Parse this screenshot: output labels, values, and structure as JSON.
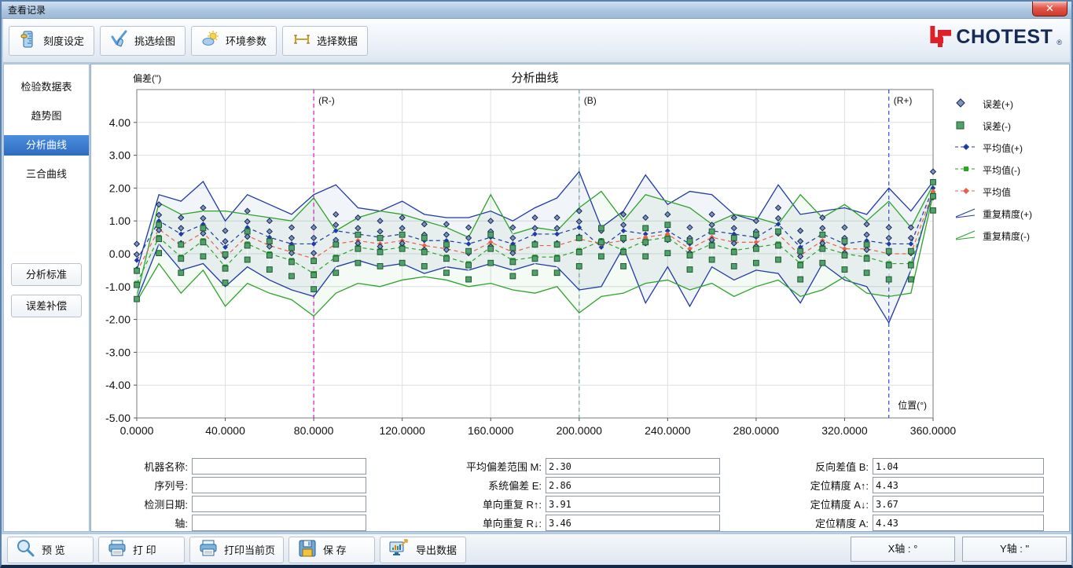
{
  "window": {
    "title": "查看记录",
    "close_glyph": "✕"
  },
  "brand": {
    "name": "CHOTEST",
    "registered": "®",
    "navy": "#152a56",
    "red": "#e02028"
  },
  "toolbar": {
    "buttons": [
      {
        "label": "刻度设定",
        "icon": "ruler-icon"
      },
      {
        "label": "挑选绘图",
        "icon": "pick-draw-icon"
      },
      {
        "label": "环境参数",
        "icon": "environment-icon"
      },
      {
        "label": "选择数据",
        "icon": "select-data-icon"
      }
    ]
  },
  "sidebar": {
    "items": [
      {
        "label": "检验数据表",
        "active": false
      },
      {
        "label": "趋势图",
        "active": false
      },
      {
        "label": "分析曲线",
        "active": true
      },
      {
        "label": "三合曲线",
        "active": false
      }
    ],
    "buttons": [
      {
        "label": "分析标准"
      },
      {
        "label": "误差补偿"
      }
    ]
  },
  "chart_data": {
    "type": "line",
    "title": "分析曲线",
    "ylabel": "偏差(\")",
    "xlabel": "位置(°)",
    "xlim": [
      0,
      360
    ],
    "ylim": [
      -5,
      5
    ],
    "x_tick_labels": [
      "0.0000",
      "40.0000",
      "80.0000",
      "120.0000",
      "160.0000",
      "200.0000",
      "240.0000",
      "280.0000",
      "320.0000",
      "360.0000"
    ],
    "y_tick_labels": [
      "4.00",
      "3.00",
      "2.00",
      "1.00",
      "0.00",
      "-1.00",
      "-2.00",
      "-3.00",
      "-4.00",
      "-5.00"
    ],
    "grid": true,
    "legend_position": "right-outside",
    "reference_lines": [
      {
        "label": "(R-)",
        "x": 80,
        "color": "#e316c8"
      },
      {
        "label": "(B)",
        "x": 200,
        "color": "#7ba3a3"
      },
      {
        "label": "(R+)",
        "x": 340,
        "color": "#2f48d5"
      }
    ],
    "x": [
      0,
      10,
      20,
      30,
      40,
      50,
      60,
      70,
      80,
      90,
      100,
      110,
      120,
      130,
      140,
      150,
      160,
      170,
      180,
      190,
      200,
      210,
      220,
      230,
      240,
      250,
      260,
      270,
      280,
      290,
      300,
      310,
      320,
      330,
      340,
      350,
      360
    ],
    "series": [
      {
        "name": "误差(+)",
        "type": "scatter",
        "marker": "diamond",
        "color": "#15255e",
        "fill": "#7d95b5",
        "base": "mean_plus",
        "offsets": [
          0.5,
          0.18,
          -0.28
        ]
      },
      {
        "name": "误差(-)",
        "type": "scatter",
        "marker": "square",
        "color": "#1d5c2e",
        "fill": "#53a06f",
        "base": "mean_minus",
        "offsets": [
          0.38,
          -0.05,
          -0.48
        ]
      },
      {
        "name": "平均值(+)",
        "key": "mean_plus",
        "type": "dashed-line",
        "marker": "diamond",
        "color": "#1f3aa5",
        "values": [
          -0.2,
          1.0,
          0.6,
          0.9,
          0.2,
          0.8,
          0.5,
          0.3,
          0.3,
          0.7,
          0.6,
          0.5,
          0.6,
          0.4,
          0.4,
          0.3,
          0.5,
          0.3,
          0.6,
          0.6,
          0.8,
          0.2,
          0.7,
          0.6,
          0.7,
          0.3,
          0.7,
          0.6,
          0.5,
          0.9,
          0.2,
          0.6,
          0.3,
          0.4,
          0.3,
          0.3,
          2.0
        ]
      },
      {
        "name": "平均值(-)",
        "key": "mean_minus",
        "type": "dashed-line",
        "marker": "square",
        "color": "#2ea32a",
        "values": [
          -0.9,
          0.5,
          -0.1,
          0.4,
          -0.4,
          0.3,
          0.0,
          -0.2,
          -0.6,
          -0.1,
          0.2,
          0.1,
          0.2,
          0.1,
          -0.1,
          -0.3,
          0.2,
          -0.2,
          -0.1,
          -0.1,
          0.1,
          0.4,
          0.1,
          0.4,
          0.5,
          0.0,
          0.3,
          0.1,
          0.2,
          0.3,
          -0.3,
          0.2,
          0.0,
          -0.1,
          -0.3,
          -0.3,
          1.8
        ]
      },
      {
        "name": "平均值",
        "key": "mean",
        "type": "dashed-line",
        "marker": "diamond",
        "color": "#e8604c",
        "values": [
          -0.55,
          0.75,
          0.25,
          0.65,
          -0.1,
          0.55,
          0.25,
          0.05,
          -0.15,
          0.3,
          0.4,
          0.3,
          0.4,
          0.25,
          0.15,
          0.0,
          0.35,
          0.05,
          0.25,
          0.25,
          0.45,
          0.3,
          0.4,
          0.5,
          0.6,
          0.15,
          0.5,
          0.35,
          0.35,
          0.6,
          -0.05,
          0.4,
          0.15,
          0.15,
          0.0,
          0.0,
          1.9
        ]
      },
      {
        "name": "重复精度(+)",
        "type": "envelope",
        "color": "#1f3aa5",
        "band": "rgba(59,95,158,0.07)",
        "hi": [
          -0.5,
          1.8,
          1.6,
          2.2,
          1.0,
          1.8,
          1.5,
          1.2,
          1.8,
          2.1,
          1.4,
          1.3,
          1.6,
          1.2,
          1.1,
          1.1,
          1.3,
          1.0,
          1.4,
          1.7,
          2.5,
          0.8,
          1.3,
          2.4,
          1.5,
          1.9,
          1.8,
          1.2,
          1.0,
          2.1,
          1.2,
          1.3,
          1.4,
          1.2,
          2.0,
          1.3,
          2.2
        ],
        "lo": [
          -1.4,
          0.3,
          -0.5,
          -0.3,
          -1.0,
          -0.4,
          -0.8,
          -1.1,
          -1.3,
          -0.4,
          -0.2,
          -0.4,
          -0.3,
          -0.6,
          -0.4,
          -0.5,
          -0.3,
          -0.5,
          -0.3,
          -0.4,
          -1.1,
          -1.0,
          0.2,
          -1.5,
          -0.4,
          -1.6,
          -0.4,
          -0.8,
          -0.5,
          -0.6,
          -1.5,
          -0.3,
          -0.8,
          -1.0,
          -2.1,
          -0.5,
          1.9
        ]
      },
      {
        "name": "重复精度(-)",
        "type": "envelope",
        "color": "#2ea32a",
        "band": "rgba(46,163,42,0.05)",
        "hi": [
          -1.3,
          1.55,
          1.2,
          1.3,
          1.3,
          1.2,
          1.1,
          1.0,
          1.7,
          0.7,
          1.1,
          1.3,
          1.2,
          1.0,
          0.8,
          0.5,
          1.8,
          0.6,
          0.8,
          0.7,
          1.4,
          1.9,
          1.0,
          1.8,
          1.6,
          1.4,
          0.9,
          1.2,
          1.1,
          0.9,
          1.8,
          1.1,
          1.5,
          1.0,
          1.6,
          0.8,
          2.1
        ],
        "lo": [
          -1.45,
          -0.3,
          -1.2,
          -0.5,
          -1.6,
          -0.9,
          -1.2,
          -1.4,
          -1.9,
          -1.2,
          -0.9,
          -1.0,
          -0.8,
          -0.7,
          -0.8,
          -1.0,
          -0.9,
          -1.1,
          -1.2,
          -1.0,
          -1.8,
          -1.3,
          -1.2,
          -0.9,
          -0.8,
          -1.1,
          -0.9,
          -1.3,
          -1.0,
          -0.8,
          -1.3,
          -1.1,
          -0.7,
          -1.2,
          -1.3,
          -1.2,
          1.8
        ]
      }
    ]
  },
  "form": {
    "left": [
      {
        "label": "机器名称:",
        "value": ""
      },
      {
        "label": "序列号:",
        "value": ""
      },
      {
        "label": "检测日期:",
        "value": ""
      },
      {
        "label": "轴:",
        "value": ""
      }
    ],
    "middle": [
      {
        "label": "平均偏差范围 M:",
        "value": "2.30"
      },
      {
        "label": "系统偏差 E:",
        "value": "2.86"
      },
      {
        "label": "单向重复 R↑:",
        "value": "3.91"
      },
      {
        "label": "单向重复 R↓:",
        "value": "3.46"
      }
    ],
    "right": [
      {
        "label": "反向差值 B:",
        "value": "1.04"
      },
      {
        "label": "定位精度 A↑:",
        "value": "4.43"
      },
      {
        "label": "定位精度 A↓:",
        "value": "3.67"
      },
      {
        "label": "定位精度 A:",
        "value": "4.43"
      }
    ]
  },
  "bottom_bar": {
    "buttons": [
      {
        "label": "预 览",
        "icon": "preview-icon"
      },
      {
        "label": "打 印",
        "icon": "print-icon"
      },
      {
        "label": "打印当前页",
        "icon": "print-icon"
      },
      {
        "label": "保 存",
        "icon": "save-icon"
      },
      {
        "label": "导出数据",
        "icon": "export-icon"
      }
    ],
    "axis_buttons": [
      {
        "label": "X轴 : °"
      },
      {
        "label": "Y轴 : \""
      }
    ]
  }
}
